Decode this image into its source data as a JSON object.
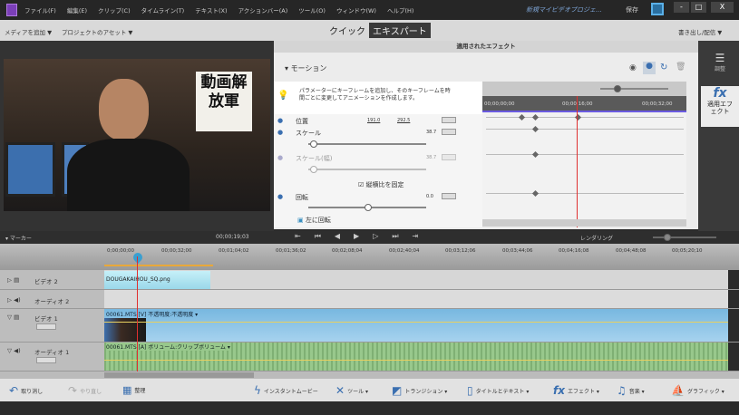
{
  "app": {
    "menu": [
      "ファイル(F)",
      "編集(E)",
      "クリップ(C)",
      "タイムライン(T)",
      "テキスト(X)",
      "アクションバー(A)",
      "ツール(O)",
      "ウィンドウ(W)",
      "ヘルプ(H)"
    ],
    "project_title": "新規マイビデオプロジェ...",
    "save_label": "保存"
  },
  "toolbar": {
    "add_media": "メディアを追加 ▼",
    "project_assets": "プロジェクトのアセット ▼",
    "mode_quick": "クイック",
    "mode_expert": "エキスパート",
    "export": "書き出し/配信 ▼"
  },
  "preview": {
    "sign_text": "動画解放軍"
  },
  "effects": {
    "title": "適用されたエフェクト",
    "section": "モーション",
    "hint": "パラメーターにキーフレームを追加し、そのキーフレームを時間ごとに変更してアニメーションを作成します。",
    "ruler": [
      "00;00;00;00",
      "00;00;16;00",
      "00;00;32;00"
    ],
    "params": [
      {
        "label": "位置",
        "value": "191.0",
        "value2": "292.5"
      },
      {
        "label": "スケール",
        "value": "38.7"
      },
      {
        "label": "スケール(幅)",
        "value": "38.7"
      },
      {
        "label": "回転",
        "value": "0.0"
      }
    ],
    "lock_aspect": "縦横比を固定",
    "rotate_left": "左に回転"
  },
  "sidebar": {
    "adjust": "調整",
    "applied_fx": "適用エフェクト"
  },
  "timeline": {
    "marker": "マーカー",
    "timecode": "00;00;19;03",
    "rendering": "レンダリング",
    "ticks": [
      "0;00;00;00",
      "00;00;32;00",
      "00;01;04;02",
      "00;01;36;02",
      "00;02;08;04",
      "00;02;40;04",
      "00;03;12;06",
      "00;03;44;06",
      "00;04;16;08",
      "00;04;48;08",
      "00;05;20;10"
    ],
    "tracks": [
      {
        "name": "ビデオ 2",
        "clip": "DOUGAKAIHOU_SQ.png"
      },
      {
        "name": "オーディオ 2"
      },
      {
        "name": "ビデオ 1",
        "clip": "00061.MTS [V] 不透明度:不透明度 ▾"
      },
      {
        "name": "オーディオ 1",
        "clip": "00061.MTS [A] ボリューム:クリップボリューム ▾"
      }
    ]
  },
  "actionbar": {
    "undo": "取り消し",
    "redo": "やり直し",
    "organize": "整理",
    "instant_movie": "インスタントムービー",
    "tools": "ツール ▾",
    "transitions": "トランジション ▾",
    "titles": "タイトルとテキスト ▾",
    "effects": "エフェクト ▾",
    "music": "音楽 ▾",
    "graphics": "グラフィック ▾"
  },
  "colors": {
    "accent": "#3a6fb0",
    "playhead": "#e03030",
    "video_clip": "#8ec5e6",
    "audio_clip": "#8fbf84"
  }
}
